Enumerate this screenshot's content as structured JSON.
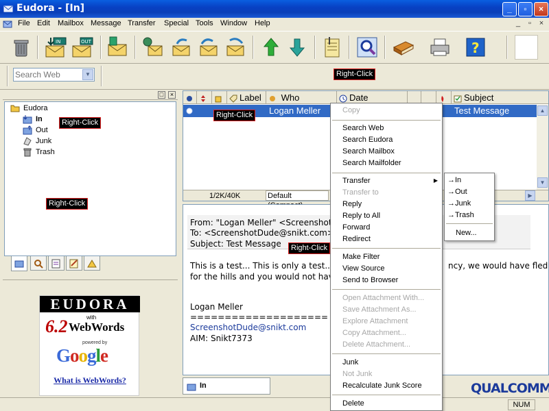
{
  "window": {
    "title": "Eudora - [In]",
    "controls": [
      "_",
      "▫",
      "×"
    ],
    "mdi_controls": [
      "_",
      "▫",
      "×"
    ]
  },
  "menu": [
    "File",
    "Edit",
    "Mailbox",
    "Message",
    "Transfer",
    "Special",
    "Tools",
    "Window",
    "Help"
  ],
  "toolbar": {
    "buttons": [
      "trash-icon",
      "check-mail-in-icon",
      "send-mail-out-icon",
      "new-message-icon",
      "reply-icon",
      "reply-all-icon",
      "forward-icon",
      "redirect-icon",
      "previous-message-icon",
      "next-message-icon",
      "attach-file-icon",
      "find-icon",
      "address-book-icon",
      "print-icon",
      "help-icon"
    ]
  },
  "search": {
    "placeholder": "Search Web"
  },
  "annotations": {
    "right_click": "Right-Click"
  },
  "tree": {
    "root": "Eudora",
    "items": [
      "In",
      "Out",
      "Junk",
      "Trash"
    ]
  },
  "ad": {
    "brand": "EUDORA",
    "version": "6.2",
    "with": "with",
    "product": "WebWords",
    "powered_by": "powered by",
    "google": "Google",
    "link": "What is WebWords?"
  },
  "mailbox": {
    "columns": {
      "label": "Label",
      "who": "Who",
      "date": "Date",
      "subject": "Subject"
    },
    "selected_row": {
      "who": "Logan Meller",
      "subject": "Test Message"
    },
    "status_size": "1/2K/40K",
    "view_mode": "Default (Compact)"
  },
  "preview": {
    "from": "From: \"Logan Meller\" <ScreenshotD",
    "to": "To: <ScreenshotDude@snikt.com>",
    "subject": "Subject: Test Message",
    "body_line1_a": "This is a test... This is only a test... Ha",
    "body_line1_b": "ncy, we would have fled",
    "body_line2": "for the hills and you would not have be",
    "signature_name": "Logan Meller",
    "signature_rule": "====================",
    "signature_email": "ScreenshotDude@snikt.com",
    "signature_aim": "AIM: Snikt7373"
  },
  "mailbox_tab": "In",
  "brand_logo": "QUALCOMM",
  "status": {
    "num": "NUM"
  },
  "context_menu": {
    "items": [
      {
        "label": "Copy",
        "disabled": true
      },
      {
        "label": "Search Web",
        "disabled": false
      },
      {
        "label": "Search Eudora",
        "disabled": false
      },
      {
        "label": "Search Mailbox",
        "disabled": false
      },
      {
        "label": "Search Mailfolder",
        "disabled": false
      },
      {
        "label": "Transfer",
        "disabled": false
      },
      {
        "label": "Transfer to",
        "disabled": true
      },
      {
        "label": "Reply",
        "disabled": false
      },
      {
        "label": "Reply to All",
        "disabled": false
      },
      {
        "label": "Forward",
        "disabled": false
      },
      {
        "label": "Redirect",
        "disabled": false
      },
      {
        "label": "Make Filter",
        "disabled": false
      },
      {
        "label": "View Source",
        "disabled": false
      },
      {
        "label": "Send to Browser",
        "disabled": false
      },
      {
        "label": "Open Attachment With...",
        "disabled": true
      },
      {
        "label": "Save Attachment As...",
        "disabled": true
      },
      {
        "label": "Explore Attachment",
        "disabled": true
      },
      {
        "label": "Copy Attachment...",
        "disabled": true
      },
      {
        "label": "Delete Attachment...",
        "disabled": true
      },
      {
        "label": "Junk",
        "disabled": false
      },
      {
        "label": "Not Junk",
        "disabled": true
      },
      {
        "label": "Recalculate Junk Score",
        "disabled": false
      },
      {
        "label": "Delete",
        "disabled": false
      }
    ]
  },
  "transfer_submenu": {
    "items": [
      "→In",
      "→Out",
      "→Junk",
      "→Trash",
      "New..."
    ]
  },
  "colors": {
    "selection": "#316ac5",
    "titlebar": "#0a3fb8",
    "link": "#1b3a9b"
  }
}
